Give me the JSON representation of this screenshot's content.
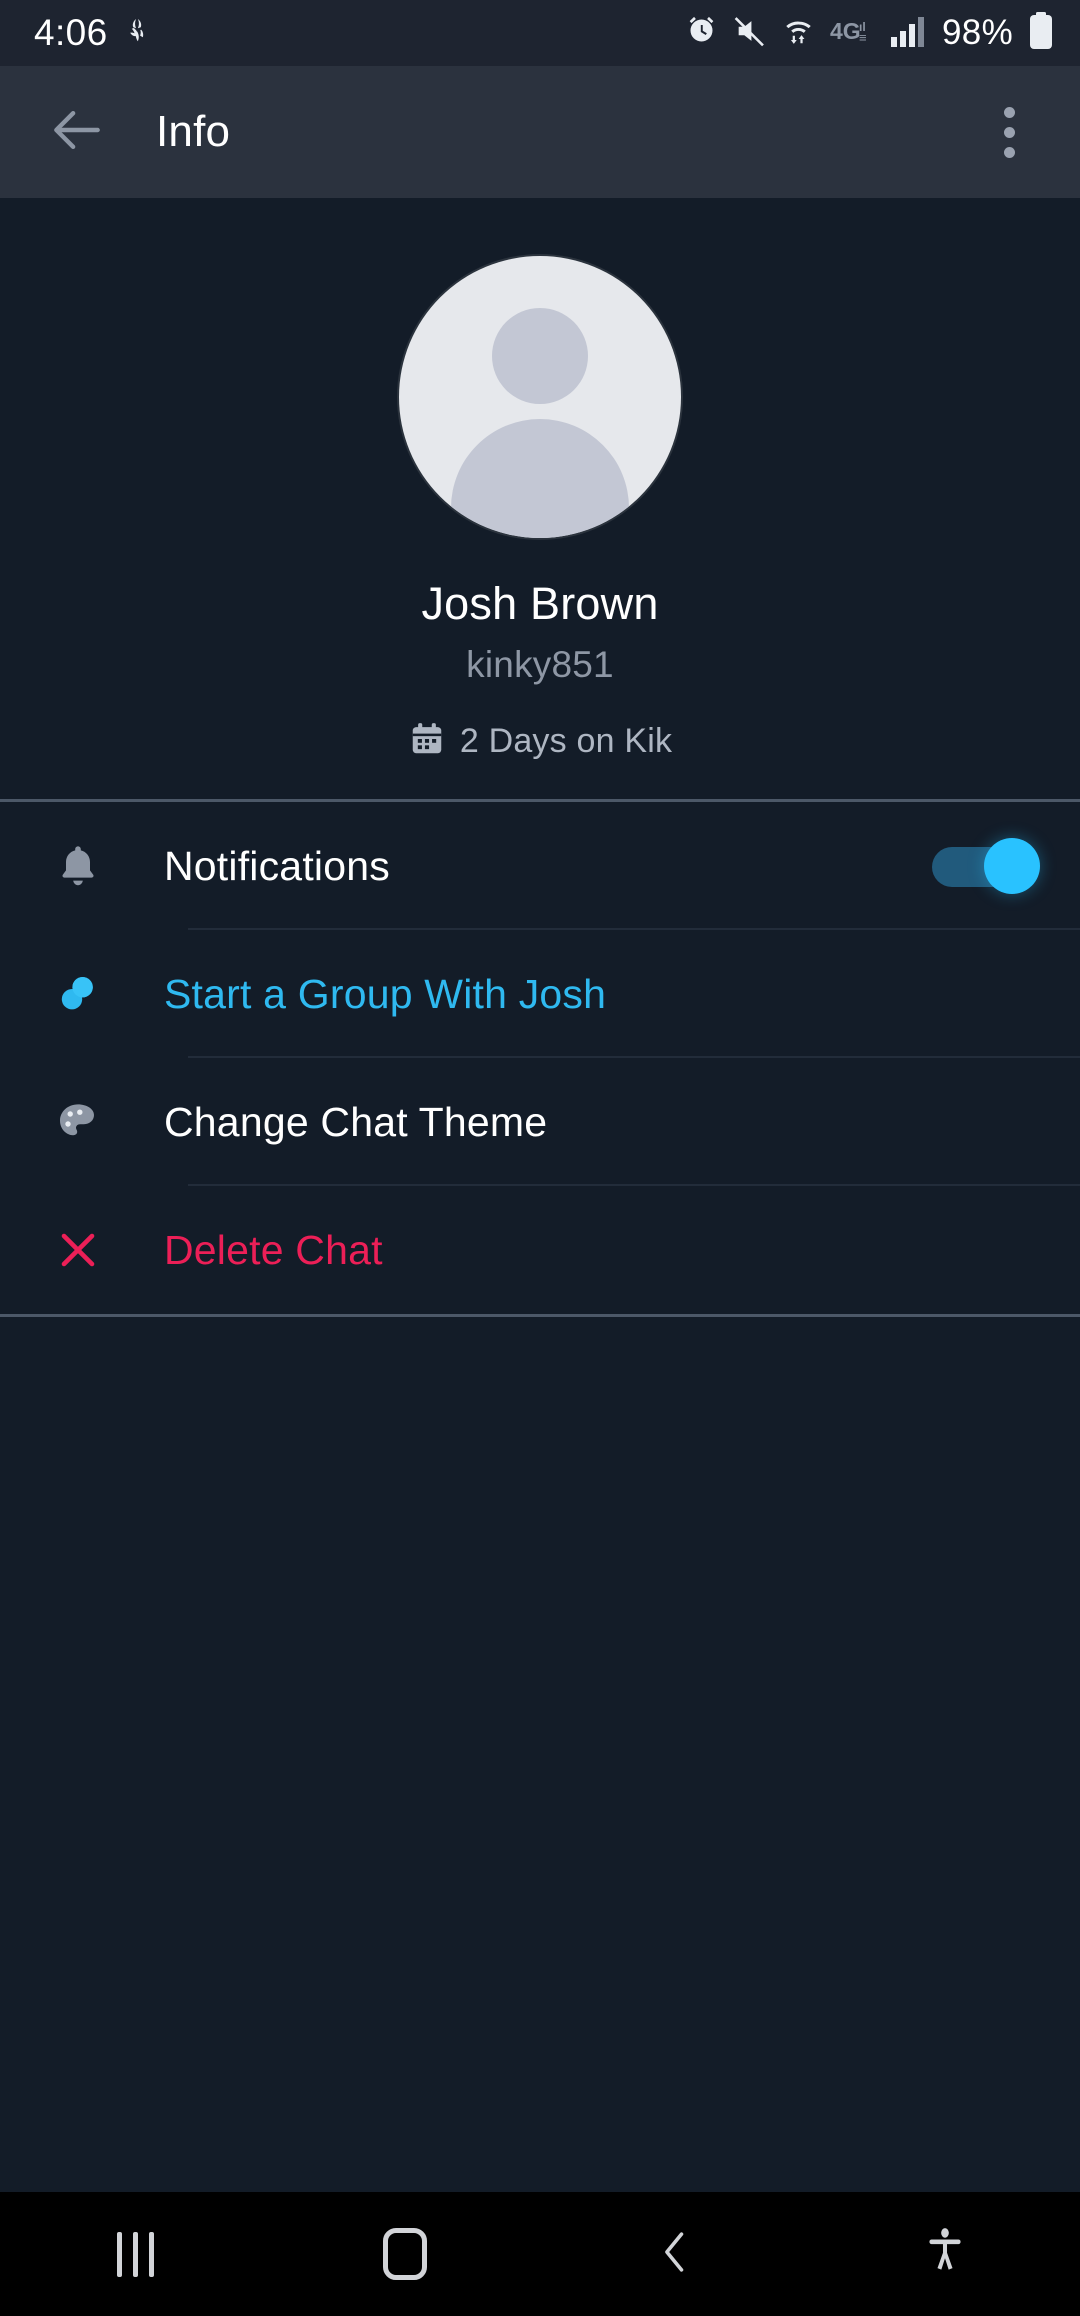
{
  "status_bar": {
    "time": "4:06",
    "battery_percent": "98%",
    "icons": [
      "app-notification-icon",
      "alarm-icon",
      "mute-icon",
      "wifi-data-icon",
      "4g-lte-icon",
      "signal-bars-icon",
      "battery-icon"
    ],
    "network_label": "4G"
  },
  "app_bar": {
    "title": "Info",
    "back_icon": "back-arrow-icon",
    "overflow_icon": "overflow-menu-icon"
  },
  "profile": {
    "avatar_icon": "default-avatar-icon",
    "display_name": "Josh Brown",
    "username": "kinky851",
    "tenure_icon": "calendar-icon",
    "tenure_text": "2 Days on Kik"
  },
  "options": [
    {
      "id": "notifications",
      "label": "Notifications",
      "icon": "bell-icon",
      "style": "white",
      "control": "toggle",
      "toggle_on": true
    },
    {
      "id": "start-group",
      "label": "Start a Group With Josh",
      "icon": "group-icon",
      "style": "blue",
      "control": "none"
    },
    {
      "id": "change-theme",
      "label": "Change Chat Theme",
      "icon": "palette-icon",
      "style": "white",
      "control": "none"
    },
    {
      "id": "delete-chat",
      "label": "Delete Chat",
      "icon": "close-x-icon",
      "style": "red",
      "control": "none"
    }
  ],
  "nav_bar": {
    "recents_icon": "recents-icon",
    "home_icon": "home-icon",
    "back_icon": "nav-back-icon",
    "accessibility_icon": "accessibility-icon"
  },
  "colors": {
    "background": "#131c28",
    "app_bar": "#2b323e",
    "status_bar": "#1e2430",
    "accent_blue": "#2fb9f0",
    "toggle_on": "#29c2ff",
    "danger_red": "#ec1f57",
    "muted_text": "#8e97a5"
  }
}
